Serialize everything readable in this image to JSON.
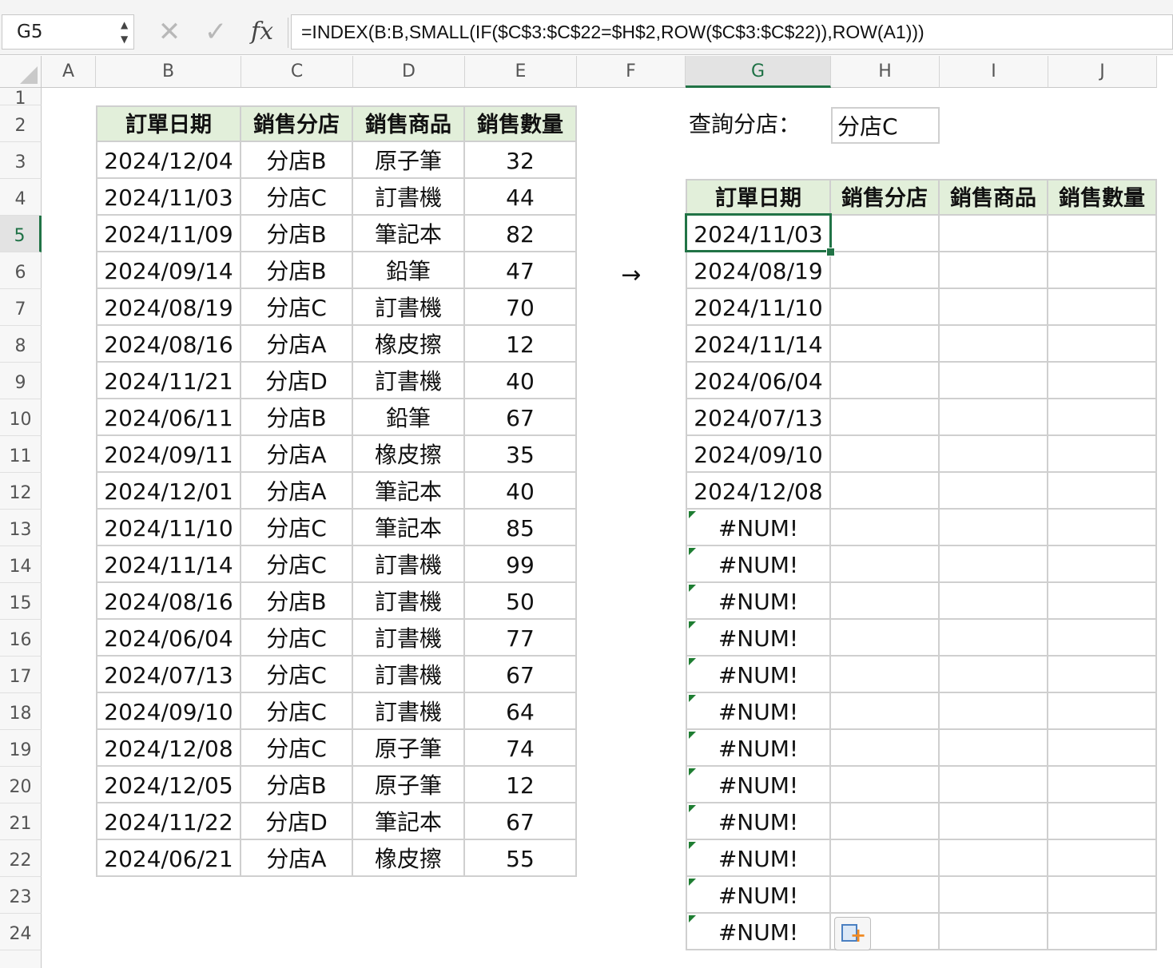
{
  "namebox": "G5",
  "formula": "=INDEX(B:B,SMALL(IF($C$3:$C$22=$H$2,ROW($C$3:$C$22)),ROW(A1)))",
  "columns": [
    "A",
    "B",
    "C",
    "D",
    "E",
    "F",
    "G",
    "H",
    "I",
    "J"
  ],
  "active_column": "G",
  "active_row": "5",
  "rows": [
    "1",
    "2",
    "3",
    "4",
    "5",
    "6",
    "7",
    "8",
    "9",
    "10",
    "11",
    "12",
    "13",
    "14",
    "15",
    "16",
    "17",
    "18",
    "19",
    "20",
    "21",
    "22",
    "23",
    "24"
  ],
  "source_table": {
    "headers": [
      "訂單日期",
      "銷售分店",
      "銷售商品",
      "銷售數量"
    ],
    "rows": [
      [
        "2024/12/04",
        "分店B",
        "原子筆",
        "32"
      ],
      [
        "2024/11/03",
        "分店C",
        "訂書機",
        "44"
      ],
      [
        "2024/11/09",
        "分店B",
        "筆記本",
        "82"
      ],
      [
        "2024/09/14",
        "分店B",
        "鉛筆",
        "47"
      ],
      [
        "2024/08/19",
        "分店C",
        "訂書機",
        "70"
      ],
      [
        "2024/08/16",
        "分店A",
        "橡皮擦",
        "12"
      ],
      [
        "2024/11/21",
        "分店D",
        "訂書機",
        "40"
      ],
      [
        "2024/06/11",
        "分店B",
        "鉛筆",
        "67"
      ],
      [
        "2024/09/11",
        "分店A",
        "橡皮擦",
        "35"
      ],
      [
        "2024/12/01",
        "分店A",
        "筆記本",
        "40"
      ],
      [
        "2024/11/10",
        "分店C",
        "筆記本",
        "85"
      ],
      [
        "2024/11/14",
        "分店C",
        "訂書機",
        "99"
      ],
      [
        "2024/08/16",
        "分店B",
        "訂書機",
        "50"
      ],
      [
        "2024/06/04",
        "分店C",
        "訂書機",
        "77"
      ],
      [
        "2024/07/13",
        "分店C",
        "訂書機",
        "67"
      ],
      [
        "2024/09/10",
        "分店C",
        "訂書機",
        "64"
      ],
      [
        "2024/12/08",
        "分店C",
        "原子筆",
        "74"
      ],
      [
        "2024/12/05",
        "分店B",
        "原子筆",
        "12"
      ],
      [
        "2024/11/22",
        "分店D",
        "筆記本",
        "67"
      ],
      [
        "2024/06/21",
        "分店A",
        "橡皮擦",
        "55"
      ]
    ]
  },
  "arrow": "→",
  "query": {
    "label": "查詢分店：",
    "value": "分店C"
  },
  "result_table": {
    "headers": [
      "訂單日期",
      "銷售分店",
      "銷售商品",
      "銷售數量"
    ],
    "g_values": [
      "2024/11/03",
      "2024/08/19",
      "2024/11/10",
      "2024/11/14",
      "2024/06/04",
      "2024/07/13",
      "2024/09/10",
      "2024/12/08",
      "#NUM!",
      "#NUM!",
      "#NUM!",
      "#NUM!",
      "#NUM!",
      "#NUM!",
      "#NUM!",
      "#NUM!",
      "#NUM!",
      "#NUM!",
      "#NUM!",
      "#NUM!"
    ]
  },
  "colors": {
    "header_fill": "#e2efda",
    "accent": "#217346",
    "error_flag": "#1e7d32",
    "paste_plus": "#f08a24"
  }
}
